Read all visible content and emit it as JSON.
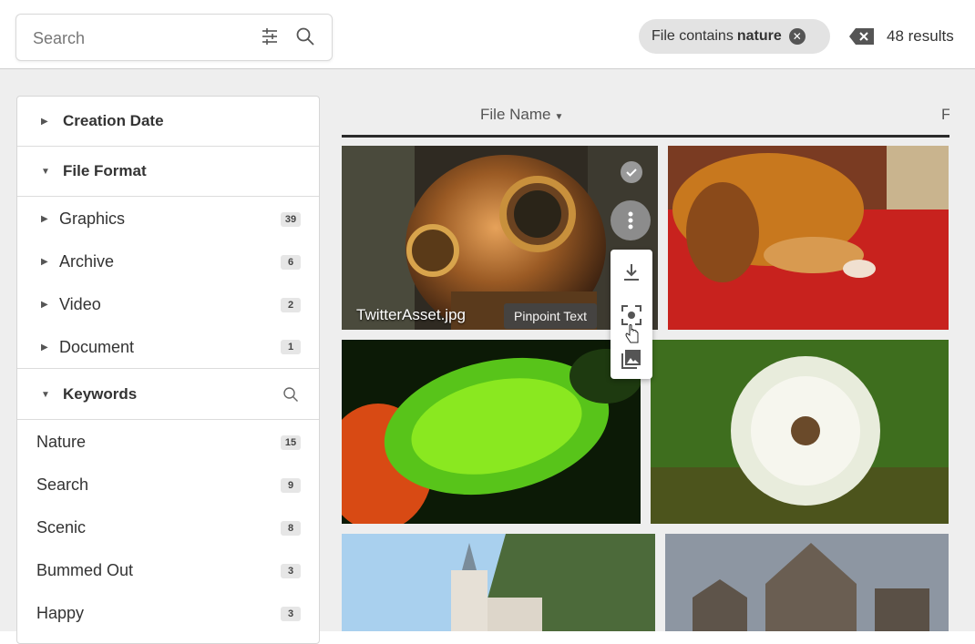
{
  "search": {
    "placeholder": "Search"
  },
  "filter_chip": {
    "label": "File contains",
    "value": "nature"
  },
  "results": {
    "count": "48 results"
  },
  "facets": {
    "creation_date": {
      "title": "Creation Date",
      "expanded": false
    },
    "file_format": {
      "title": "File Format",
      "expanded": true,
      "items": [
        {
          "label": "Graphics",
          "count": "39"
        },
        {
          "label": "Archive",
          "count": "6"
        },
        {
          "label": "Video",
          "count": "2"
        },
        {
          "label": "Document",
          "count": "1"
        }
      ]
    },
    "keywords": {
      "title": "Keywords",
      "expanded": true,
      "items": [
        {
          "label": "Nature",
          "count": "15"
        },
        {
          "label": "Search",
          "count": "9"
        },
        {
          "label": "Scenic",
          "count": "8"
        },
        {
          "label": "Bummed Out",
          "count": "3"
        },
        {
          "label": "Happy",
          "count": "3"
        }
      ]
    }
  },
  "grid": {
    "sort_label": "File Name",
    "next_column_label": "File",
    "tiles": [
      {
        "caption": "TwitterAsset.jpg",
        "subject": "diving helmet"
      },
      {
        "subject": "sleeping dog on red carpet"
      },
      {
        "subject": "green fuzzy seed pod"
      },
      {
        "subject": "dandelion"
      },
      {
        "subject": "castle"
      },
      {
        "subject": "gothic church"
      }
    ]
  },
  "tile_actions": {
    "tooltip": "Pinpoint Text",
    "icons": [
      "check-icon",
      "more-vert-icon",
      "download-icon",
      "pinpoint-text-icon",
      "image-gallery-icon"
    ]
  }
}
